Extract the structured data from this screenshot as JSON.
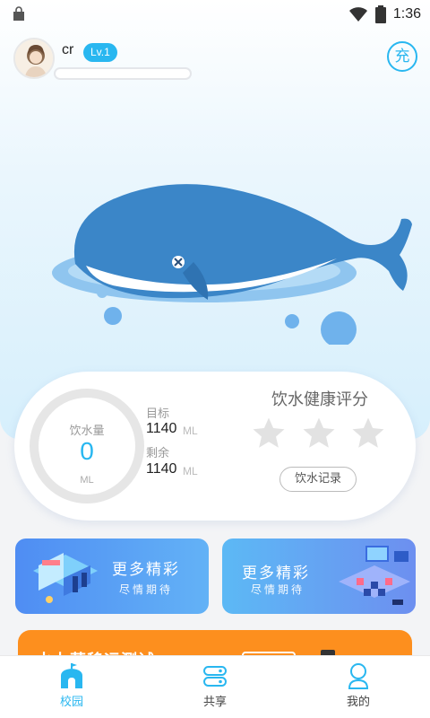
{
  "status_bar": {
    "time": "1:36"
  },
  "profile": {
    "name": "cr",
    "level": "Lv.1",
    "xp_fraction": 0.0,
    "charge_label": "充"
  },
  "water": {
    "title": "饮水量",
    "value": "0",
    "unit": "ML",
    "target_label": "目标",
    "target_value": "1140",
    "target_unit": "ML",
    "remaining_label": "剩余",
    "remaining_value": "1140",
    "remaining_unit": "ML"
  },
  "health_score": {
    "title": "饮水健康评分",
    "stars_filled": 0,
    "stars_total": 3,
    "record_button": "饮水记录"
  },
  "promos": [
    {
      "title": "更多精彩",
      "subtitle": "尽情期待"
    },
    {
      "title": "更多精彩",
      "subtitle": "尽情期待"
    }
  ],
  "banner": {
    "text": "水力蒸移运测试"
  },
  "tabs": [
    {
      "label": "校园",
      "icon": "school-icon",
      "active": true
    },
    {
      "label": "共享",
      "icon": "share-icon",
      "active": false
    },
    {
      "label": "我的",
      "icon": "profile-icon",
      "active": false
    }
  ],
  "colors": {
    "accent": "#29b7f0",
    "whale": "#3b86c8",
    "banner": "#fd8f1e"
  }
}
